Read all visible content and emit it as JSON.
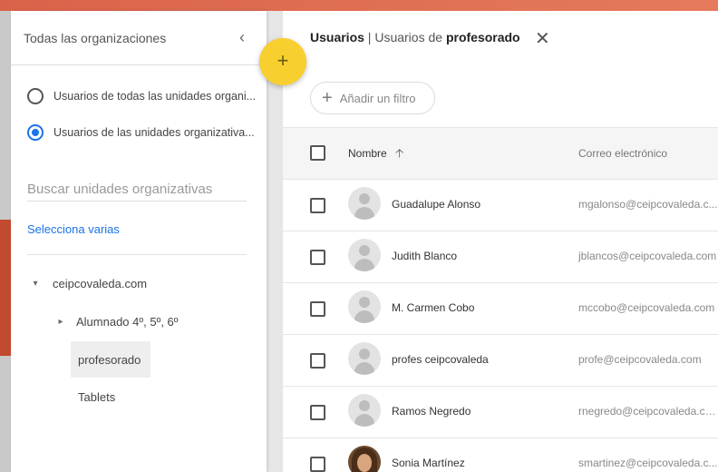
{
  "left_panel": {
    "title": "Todas las organizaciones",
    "collapse_icon": "chevron-left-icon",
    "radio_all": "Usuarios de todas las unidades organi...",
    "radio_selected": "Usuarios de las unidades organizativa...",
    "search_placeholder": "Buscar unidades organizativas",
    "select_multiple": "Selecciona varias",
    "tree": {
      "root": "ceipcovaleda.com",
      "children": [
        "Alumnado 4º, 5º, 6º",
        "profesorado",
        "Tablets"
      ]
    }
  },
  "fab_label": "+",
  "header": {
    "title_main": "Usuarios",
    "title_sep": " | Usuarios de ",
    "title_ou": "profesorado"
  },
  "filter": {
    "label": "Añadir un filtro"
  },
  "table": {
    "col_name": "Nombre",
    "col_email": "Correo electrónico",
    "rows": [
      {
        "name": "Guadalupe Alonso",
        "email": "mgalonso@ceipcovaleda.c..."
      },
      {
        "name": "Judith Blanco",
        "email": "jblancos@ceipcovaleda.com"
      },
      {
        "name": "M. Carmen Cobo",
        "email": "mccobo@ceipcovaleda.com"
      },
      {
        "name": "profes ceipcovaleda",
        "email": "profe@ceipcovaleda.com"
      },
      {
        "name": "Ramos Negredo",
        "email": "rnegredo@ceipcovaleda.com"
      },
      {
        "name": "Sonia Martínez",
        "email": "smartinez@ceipcovaleda.c..."
      }
    ]
  },
  "colors": {
    "accent": "#1a73e8",
    "fab": "#f7cf2f",
    "brand_bar": "#d9634a"
  }
}
